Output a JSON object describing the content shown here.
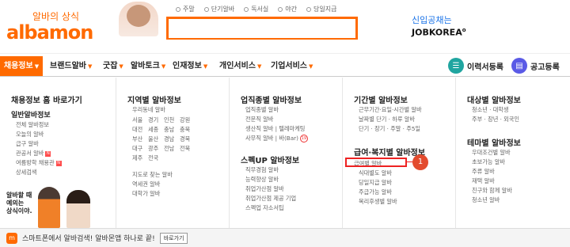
{
  "header": {
    "slogan": "알바의 상식",
    "logo": "albamon",
    "quick_links": [
      "주말",
      "단기알바",
      "독서실",
      "야간",
      "당일지급"
    ],
    "search": {
      "placeholder": "",
      "value": ""
    },
    "jobkorea_line1": "신입공채는",
    "jobkorea_line2": "JOBKOREA"
  },
  "nav": {
    "items": [
      "채용정보",
      "브랜드알바",
      "굿잡",
      "알바토크",
      "인재정보",
      "개인서비스",
      "기업서비스"
    ],
    "resume_button": "이력서등록",
    "post_button": "공고등록"
  },
  "sidebar": {
    "title": "채용정보 홈 바로가기",
    "section": "일반알바정보",
    "items": [
      "전체 알바정보",
      "오늘의 알바",
      "급구 알바",
      "관공서 알바",
      "여름방학 채용관",
      "상세검색"
    ],
    "badge_new": "N",
    "promo_text": [
      "알바할 때",
      "예의는",
      "상식이야."
    ]
  },
  "col_region": {
    "title": "지역별 알바정보",
    "sub": "우리동네 알바",
    "rows": [
      [
        "서울",
        "경기",
        "인천",
        "강원"
      ],
      [
        "대전",
        "세종",
        "충남",
        "충북"
      ],
      [
        "부산",
        "울산",
        "경남",
        "경북"
      ],
      [
        "대구",
        "광주",
        "전남",
        "전북"
      ],
      [
        "제주",
        "전국"
      ]
    ],
    "extras": [
      "지도로 찾는 알바",
      "역세권 알바",
      "대학가 알바"
    ]
  },
  "col_industry": {
    "title": "업직종별 알바정보",
    "items": [
      "업직종별 알바",
      "전문직 알바",
      "생산직 알바",
      "사무직 알바"
    ],
    "tags": [
      "텔레마케팅",
      "바(Bar)"
    ],
    "age_badge": "19",
    "spec_title": "스펙UP 알바정보",
    "spec_items": [
      "직무경험 알바",
      "능력향상 알바",
      "취업가산점 알바",
      "취업가산점 제공 기업",
      "스펙업 자소서팁"
    ]
  },
  "col_period": {
    "title": "기간별 알바정보",
    "lines": [
      "근무기간·요일·시간별 알바",
      "날짜별 단기 · 하루 알바",
      "단기 · 장기 · 주말 · 주5일"
    ],
    "benefit_title": "급여·복지별 알바정보",
    "benefit_items": [
      "급여별 알바",
      "식대별도 알바",
      "당일지급 알바",
      "주급가능 알바",
      "복리후생별 알바"
    ],
    "marker": "1"
  },
  "col_target": {
    "title": "대상별 알바정보",
    "lines": [
      "청소년 · 대학생",
      "주부 · 장년 · 외국인"
    ],
    "theme_title": "테마별 알바정보",
    "theme_items": [
      "우대조건별 알바",
      "초보가능 알바",
      "주류 알바",
      "재택 알바",
      "친구와 함께 알바",
      "청소년 알바"
    ]
  },
  "bottom": {
    "app_icon": "m",
    "text": "스마트폰에서 알바검색! 알바몬앱 하나로 끝!",
    "button": "바로가기"
  },
  "colors": {
    "brand": "#ff6a00",
    "highlight": "#e22222",
    "jobkorea": "#1a73e8"
  }
}
